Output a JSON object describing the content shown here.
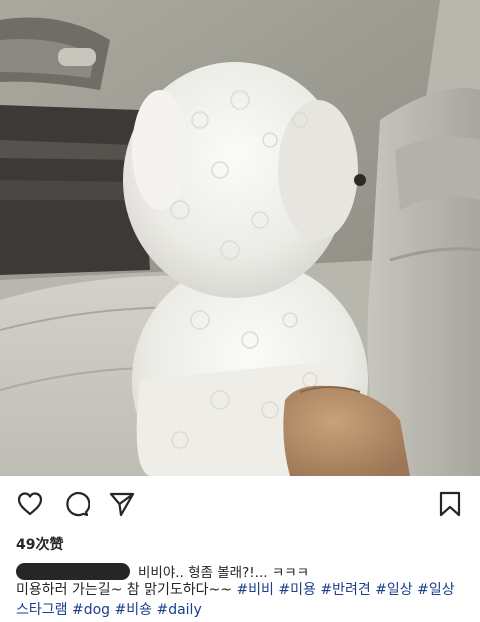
{
  "post": {
    "likes": "49次赞",
    "comment_text": "비비야.. 형좀 볼래?!... ㅋㅋㅋ",
    "caption_text": "미용하러 가는길~ 참 맑기도하다~~",
    "hashtags": [
      "#비비",
      "#미용",
      "#반려견",
      "#일상",
      "#일상스타그램",
      "#dog",
      "#비숑",
      "#daily"
    ]
  },
  "icons": {
    "like": "heart-icon",
    "comment": "comment-icon",
    "share": "send-icon",
    "save": "bookmark-icon"
  },
  "colors": {
    "text": "#262626",
    "hashtag": "#1a3f8b",
    "background": "#ffffff"
  }
}
